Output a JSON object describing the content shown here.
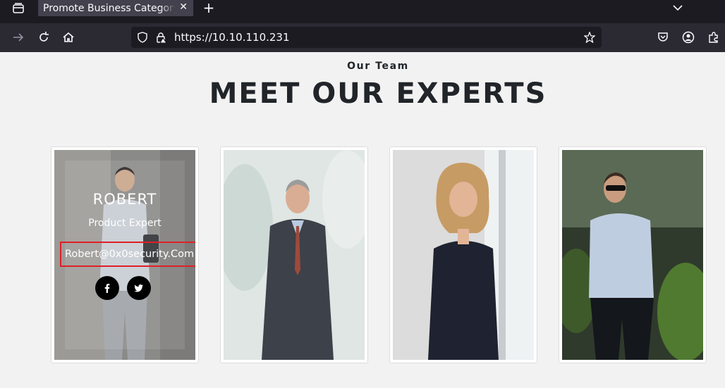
{
  "browser": {
    "tab_title": "Promote Business Category E",
    "tab_close": "✕",
    "new_tab": "+",
    "url": "https://10.10.110.231"
  },
  "team": {
    "subtitle": "Our Team",
    "title": "MEET OUR EXPERTS",
    "members": [
      {
        "name": "ROBERT",
        "role": "Product Expert",
        "email": "Robert@0x0security.Com"
      }
    ]
  },
  "colors": {
    "highlight_border": "#e01f26",
    "tab_background": "#42414d",
    "toolbar_background": "#2b2a33"
  }
}
